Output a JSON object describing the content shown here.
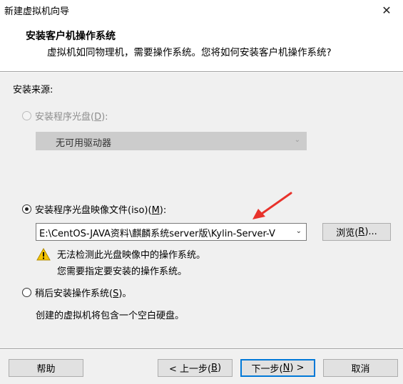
{
  "window": {
    "title": "新建虚拟机向导",
    "close_icon": "close-icon"
  },
  "header": {
    "title": "安装客户机操作系统",
    "subtitle": "虚拟机如同物理机，需要操作系统。您将如何安装客户机操作系统?"
  },
  "source": {
    "label": "安装来源:",
    "disc_option": {
      "label_pre": "安装程序光盘(",
      "mnemonic": "D",
      "label_post": "):",
      "enabled": false,
      "selected": false
    },
    "disc_dropdown": {
      "value": "无可用驱动器"
    },
    "iso_option": {
      "label_pre": "安装程序光盘映像文件(iso)(",
      "mnemonic": "M",
      "label_post": "):",
      "enabled": true,
      "selected": true
    },
    "iso_path": {
      "value": "E:\\CentOS-JAVA资料\\麒麟系统server版\\Kylin-Server-V"
    },
    "browse_button": {
      "label_pre": "浏览(",
      "mnemonic": "R",
      "label_post": ")..."
    },
    "warning": {
      "icon": "warning-icon",
      "line1": "无法检测此光盘映像中的操作系统。",
      "line2": "您需要指定要安装的操作系统。"
    },
    "later_option": {
      "label_pre": "稍后安装操作系统(",
      "mnemonic": "S",
      "label_post": ")。",
      "selected": false
    },
    "later_description": "创建的虚拟机将包含一个空白硬盘。"
  },
  "footer": {
    "help_label": "帮助",
    "back": {
      "label_pre": "< 上一步(",
      "mnemonic": "B",
      "label_post": ")"
    },
    "next": {
      "label_pre": "下一步(",
      "mnemonic": "N",
      "label_post": ") >"
    },
    "cancel_label": "取消"
  },
  "colors": {
    "content_bg": "#f0f0f0",
    "annotation_arrow": "#e8322b",
    "default_button_border": "#0078d7",
    "warning_yellow": "#f5c400"
  }
}
